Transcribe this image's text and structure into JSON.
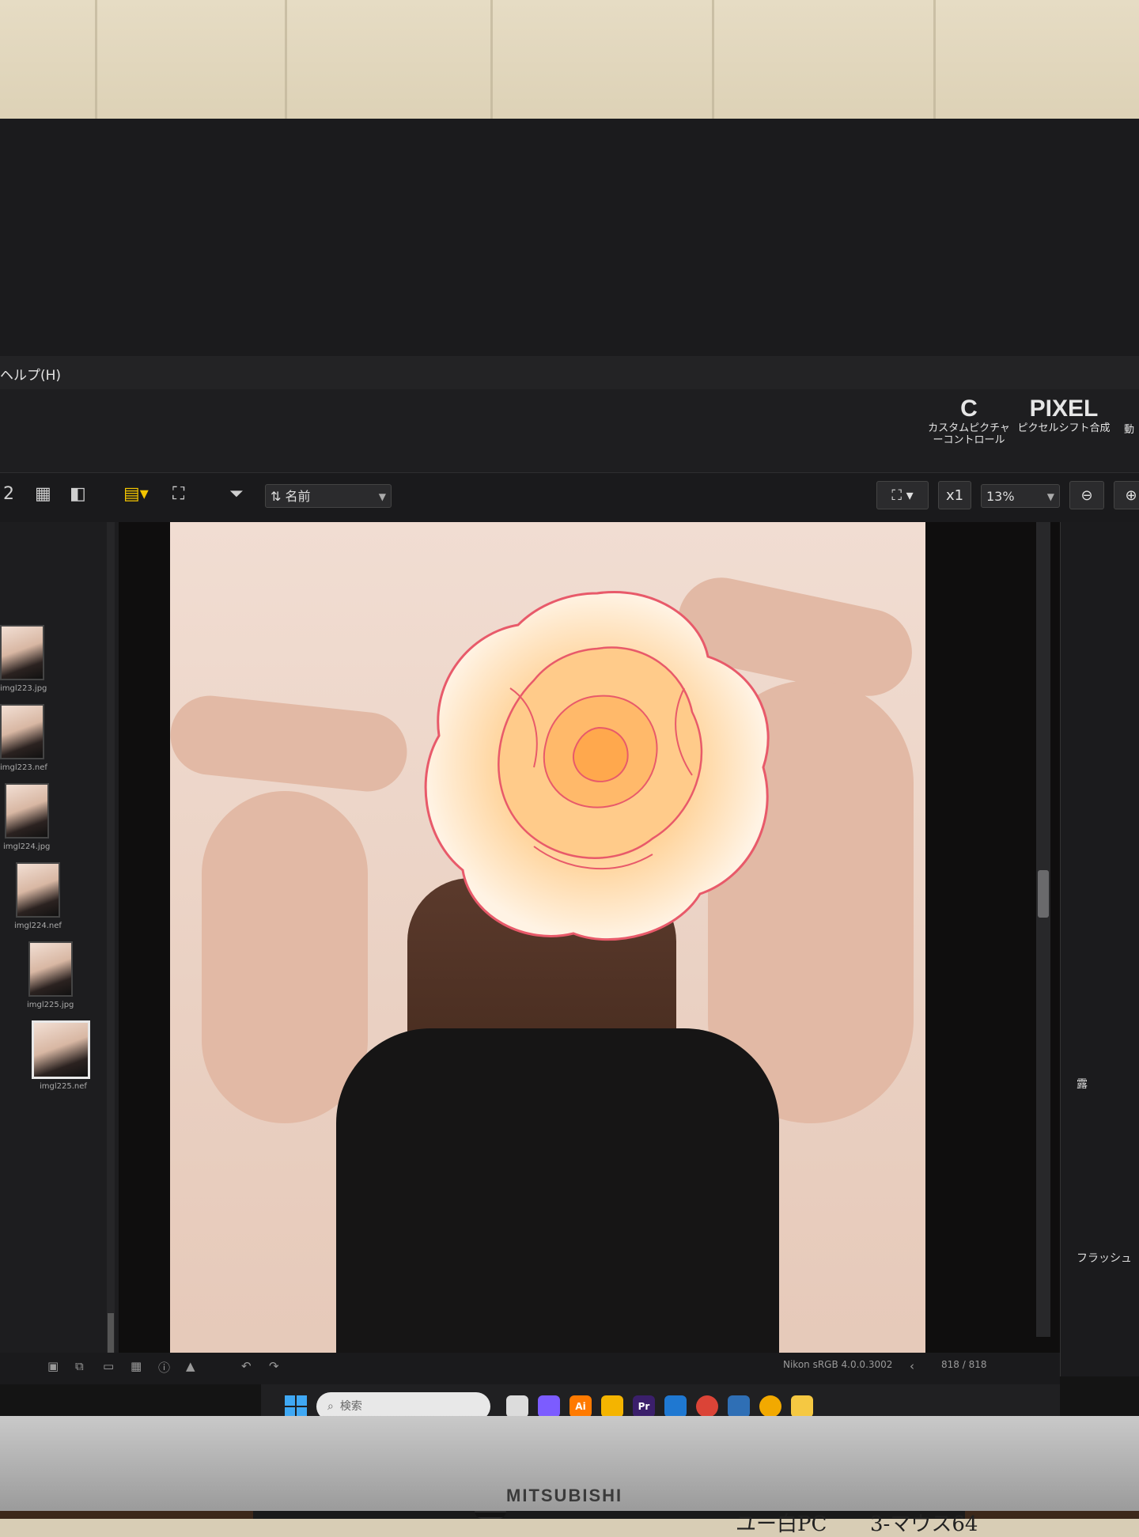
{
  "app": {
    "menu": {
      "help": "ヘルプ(H)"
    },
    "ribbon": {
      "custom_picture_control": {
        "icon": "C",
        "label": "カスタムピクチャーコントロール"
      },
      "pixel_shift": {
        "icon": "PIXEL",
        "label": "ピクセルシフト合成"
      },
      "more": {
        "label": "動"
      }
    },
    "toolbar": {
      "layout_2": "2",
      "sort_select": "名前",
      "zoom_ratio": "x1",
      "zoom_select": "13%"
    },
    "filmstrip": {
      "files": [
        "imgl223.jpg",
        "imgl223.nef",
        "imgl224.jpg",
        "imgl224.nef",
        "imgl225.jpg",
        "imgl225.nef"
      ]
    },
    "right_panel": {
      "section1": "露",
      "section2": "フラッシュ"
    },
    "status": {
      "color_profile": "Nikon sRGB 4.0.0.3002",
      "page_counter": "818 / 818"
    }
  },
  "taskbar": {
    "search_placeholder": "検索"
  },
  "monitor": {
    "brand": "MITSUBISHI",
    "label_left": "ユー白PC",
    "label_right": "3-マウス64"
  },
  "colors": {
    "accent_yellow": "#f2c400",
    "background": "#141414",
    "rose": "#ffc98a"
  }
}
